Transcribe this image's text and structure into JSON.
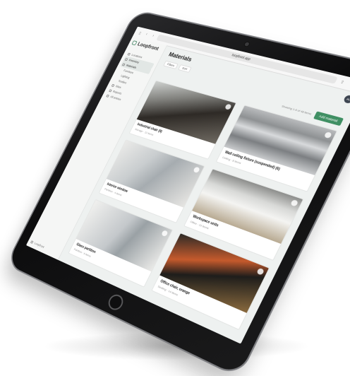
{
  "browser": {
    "url": "loopfront.app",
    "tab_icons": [
      "sidebar-icon",
      "back-icon",
      "forward-icon"
    ],
    "right_icons": [
      "share-icon",
      "plus-icon",
      "tabs-icon"
    ]
  },
  "app": {
    "brand": "Loopfront",
    "sidebar": {
      "items": [
        {
          "label": "Locations",
          "icon": "pin-icon"
        },
        {
          "label": "Inventory",
          "icon": "box-icon",
          "active": true
        },
        {
          "label": "Materials",
          "icon": "layers-icon",
          "active": true
        },
        {
          "label": "Furniture",
          "icon": "chair-icon",
          "sub": true
        },
        {
          "label": "Lighting",
          "icon": "lamp-icon",
          "sub": true
        },
        {
          "label": "Textiles",
          "icon": "tag-icon",
          "sub": true
        },
        {
          "label": "Sites",
          "icon": "map-icon"
        },
        {
          "label": "Reports",
          "icon": "chart-icon"
        },
        {
          "label": "All entries",
          "icon": "list-icon"
        }
      ],
      "footer": "Loopfront"
    },
    "main": {
      "title": "Materials",
      "avatar": "AL",
      "filters": [
        "Filters",
        "Sort"
      ],
      "results_text": "Showing 1-6 of 48 items",
      "add_button": "Add material",
      "cards": [
        {
          "title": "Industrial chair (9)",
          "sub": "Storage · 12 items"
        },
        {
          "title": "Wall ceiling fixture (suspended) (6)",
          "sub": "Ceiling · 8 items"
        },
        {
          "title": "Interior window",
          "sub": "Partition · 4 items"
        },
        {
          "title": "Workspace units",
          "sub": "Office · 10 items"
        },
        {
          "title": "Glass partition",
          "sub": "Partition · 6 items"
        },
        {
          "title": "Office chair, orange",
          "sub": "Seating · 14 items"
        }
      ]
    }
  },
  "colors": {
    "accent": "#3f8f63",
    "bezel": "#111111",
    "screen_bg": "#eef1f0"
  }
}
